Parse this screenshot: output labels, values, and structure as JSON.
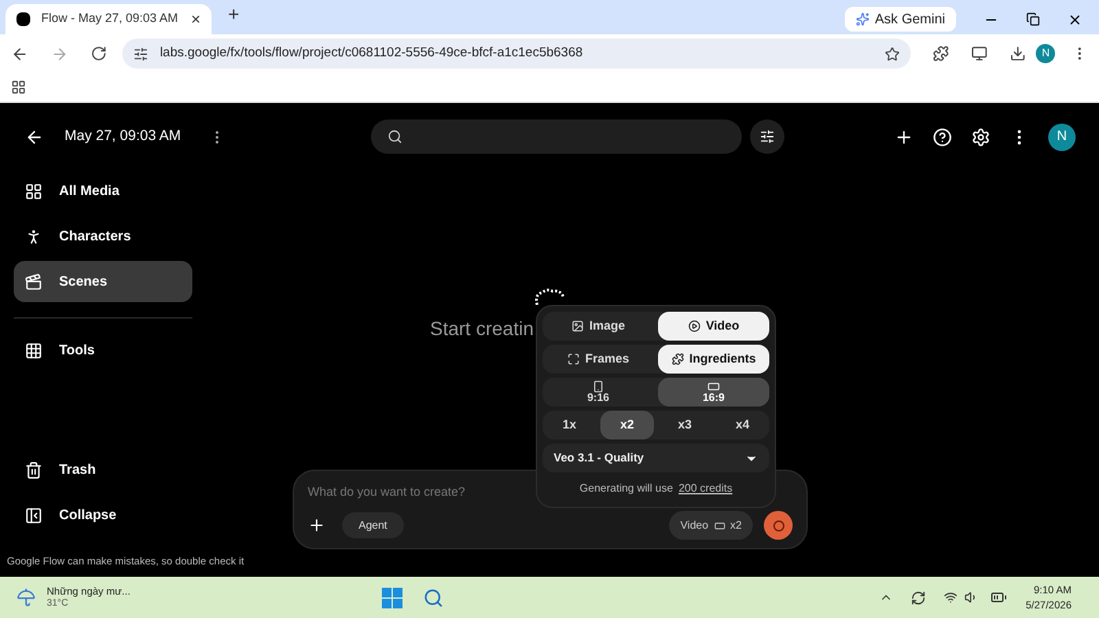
{
  "browser": {
    "tab_title": "Flow - May 27, 09:03 AM",
    "tab_close": "×",
    "new_tab": "+",
    "ask_gemini": "Ask Gemini",
    "url": "labs.google/fx/tools/flow/project/c0681102-5556-49ce-bfcf-a1c1ec5b6368",
    "profile": "N"
  },
  "header": {
    "title": "May 27, 09:03 AM",
    "avatar": "N"
  },
  "sidebar": {
    "items": [
      {
        "label": "All Media",
        "selected": false
      },
      {
        "label": "Characters",
        "selected": false
      },
      {
        "label": "Scenes",
        "selected": true
      }
    ],
    "tools": "Tools",
    "bottom": [
      "Trash",
      "Collapse"
    ]
  },
  "empty_state": "Start creatin",
  "prompt": {
    "placeholder": "What do you want to create?",
    "agent": "Agent",
    "chip_mode": "Video",
    "chip_count": "x2"
  },
  "popup": {
    "modes": [
      {
        "label": "Image",
        "selected": false
      },
      {
        "label": "Video",
        "selected": true
      }
    ],
    "inputs": [
      {
        "label": "Frames",
        "selected": false
      },
      {
        "label": "Ingredients",
        "selected": true
      }
    ],
    "aspects": [
      {
        "label": "9:16",
        "selected": false
      },
      {
        "label": "16:9",
        "selected": true
      }
    ],
    "counts": [
      {
        "label": "1x",
        "selected": false
      },
      {
        "label": "x2",
        "selected": true
      },
      {
        "label": "x3",
        "selected": false
      },
      {
        "label": "x4",
        "selected": false
      }
    ],
    "model": "Veo 3.1 - Quality",
    "credits_text": "Generating will use",
    "credits_link": "200 credits"
  },
  "disclaimer": "Google Flow can make mistakes, so double check it",
  "taskbar": {
    "weather": "Những ngày mư...",
    "temperature": "31°C",
    "time": "9:10 AM",
    "date": "5/27/2026"
  }
}
